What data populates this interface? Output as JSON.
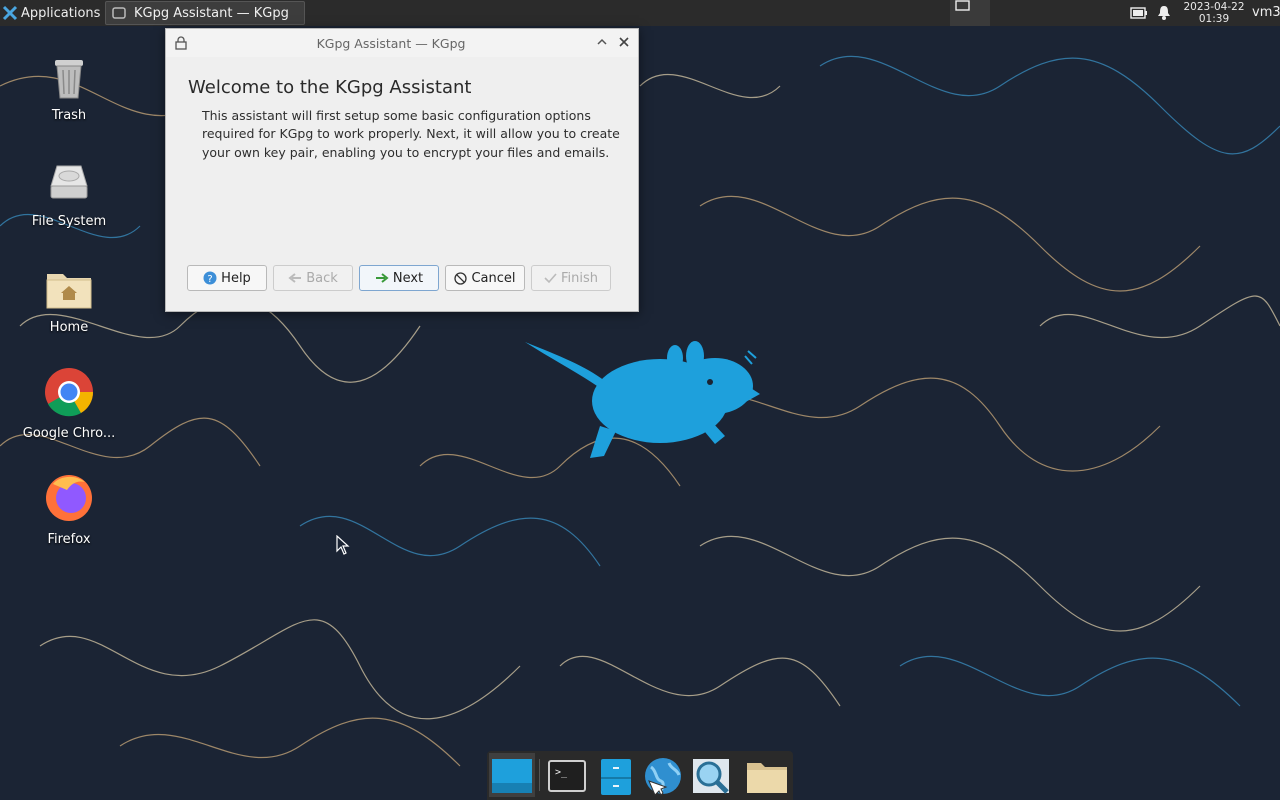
{
  "panel": {
    "applications_label": "Applications",
    "task_label": "KGpg Assistant — KGpg",
    "clock_date": "2023-04-22",
    "clock_time": "01:39",
    "user_label": "vm3"
  },
  "desktop": {
    "icons": [
      {
        "label": "Trash",
        "icon": "trash-icon"
      },
      {
        "label": "File System",
        "icon": "drive-icon"
      },
      {
        "label": "Home",
        "icon": "home-folder-icon"
      },
      {
        "label": "Google Chro...",
        "icon": "chrome-icon"
      },
      {
        "label": "Firefox",
        "icon": "firefox-icon"
      }
    ]
  },
  "dialog": {
    "title": "KGpg Assistant — KGpg",
    "heading": "Welcome to the KGpg Assistant",
    "body": "This assistant will first setup some basic configuration options required for KGpg to work properly. Next, it will allow you to create your own key pair, enabling you to encrypt your files and emails.",
    "buttons": {
      "help": "Help",
      "back": "Back",
      "next": "Next",
      "cancel": "Cancel",
      "finish": "Finish"
    }
  },
  "dock": {
    "items": [
      "show-desktop-icon",
      "terminal-icon",
      "file-manager-icon",
      "web-browser-icon",
      "app-finder-icon",
      "folder-icon"
    ]
  },
  "colors": {
    "wallpaper": "#1b2434",
    "mouse_logo": "#1ea0dc",
    "panel": "#2b2b2b",
    "dialog_bg": "#efefef"
  }
}
